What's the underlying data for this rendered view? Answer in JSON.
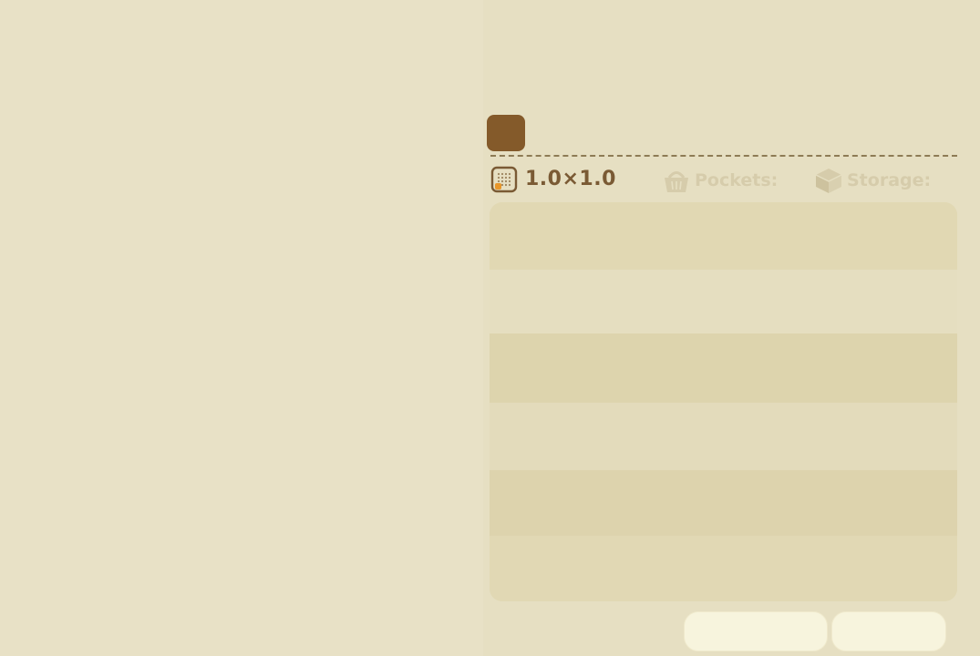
{
  "item_info": {
    "size_text": "1.0×1.0",
    "pockets_label": "Pockets:",
    "storage_label": "Storage:"
  },
  "actions": {
    "primary_label": "",
    "secondary_label": ""
  },
  "icons": {
    "category": "category-square-icon",
    "size": "grid-size-icon",
    "pockets": "basket-icon",
    "storage": "storage-box-icon"
  },
  "colors": {
    "background": "#e8e1c5",
    "accent_brown": "#845a2a",
    "text_brown": "#7a5a34",
    "muted_label": "#d6ccab",
    "button_fill": "#f7f4dd"
  }
}
